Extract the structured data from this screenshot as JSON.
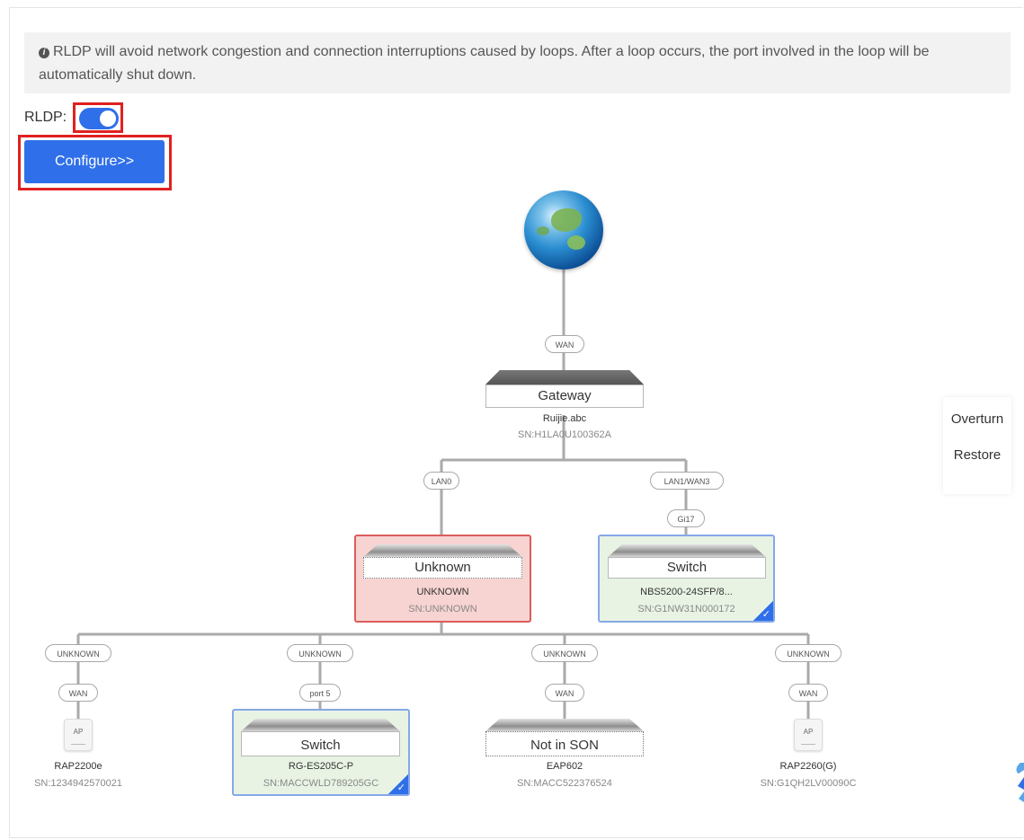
{
  "notice": {
    "icon": "info-icon",
    "text": "RLDP will avoid network congestion and connection interruptions caused by loops. After a loop occurs, the port involved in the loop will be automatically shut down."
  },
  "rldp": {
    "label": "RLDP:",
    "enabled": true
  },
  "configure": {
    "label": "Configure>>"
  },
  "colors": {
    "accent": "#2f6fe9",
    "highlight_border": "#e02020",
    "error_card_bg": "#f7d4d2",
    "ok_card_bg": "#e8f3e4"
  },
  "topology": {
    "internet": {
      "icon": "globe-icon"
    },
    "wan_port": "WAN",
    "gateway": {
      "label": "Gateway",
      "name": "Ruijie.abc",
      "sn": "SN:H1LA0U100362A"
    },
    "lan_ports": [
      "LAN0",
      "LAN1/WAN3"
    ],
    "uplink_port_switch": "Gi17",
    "unknown_device": {
      "label": "Unknown",
      "name": "UNKNOWN",
      "sn": "SN:UNKNOWN"
    },
    "switch_device": {
      "label": "Switch",
      "name": "NBS5200-24SFP/8...",
      "sn": "SN:G1NW31N000172"
    },
    "children": [
      {
        "up_port": "UNKNOWN",
        "down_port": "WAN",
        "type": "ap",
        "icon_text": "AP",
        "name": "RAP2200e",
        "sn": "SN:1234942570021"
      },
      {
        "up_port": "UNKNOWN",
        "down_port": "port 5",
        "type": "switch",
        "label": "Switch",
        "name": "RG-ES205C-P",
        "sn": "SN:MACCWLD789205GC"
      },
      {
        "up_port": "UNKNOWN",
        "down_port": "WAN",
        "type": "notinson",
        "label": "Not in SON",
        "name": "EAP602",
        "sn": "SN:MACC522376524"
      },
      {
        "up_port": "UNKNOWN",
        "down_port": "WAN",
        "type": "ap",
        "icon_text": "AP",
        "name": "RAP2260(G)",
        "sn": "SN:G1QH2LV00090C"
      }
    ]
  },
  "side_panel": {
    "overturn": "Overturn",
    "restore": "Restore"
  }
}
